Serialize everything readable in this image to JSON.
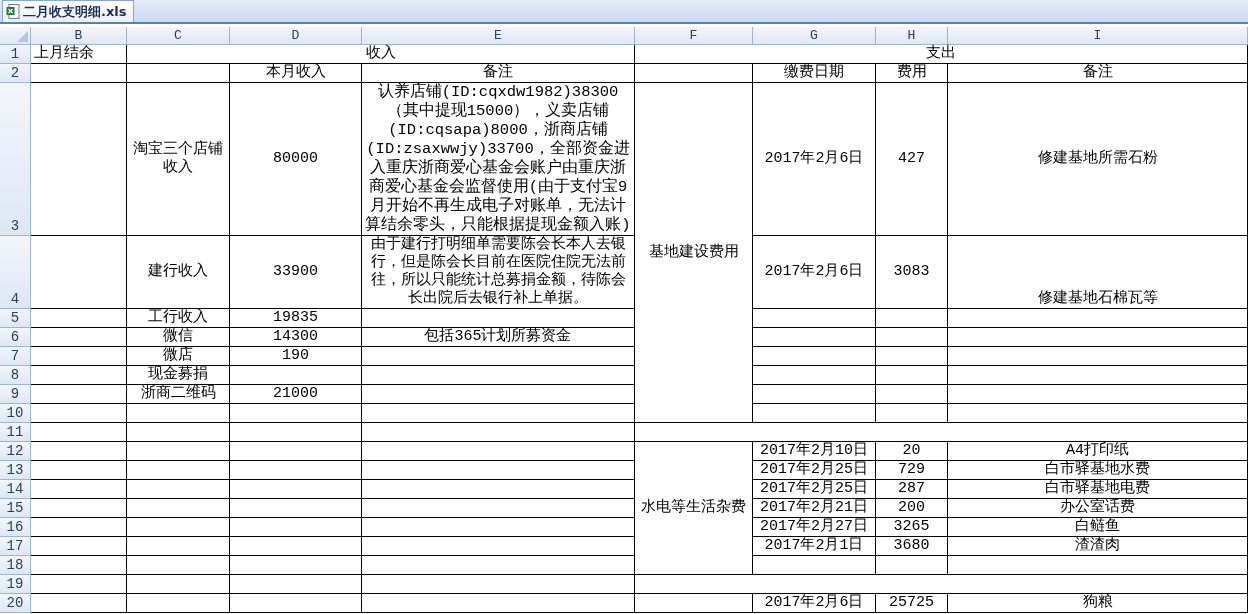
{
  "tab": {
    "title": "二月收支明细.xls",
    "selected": true
  },
  "column_headers": [
    "B",
    "C",
    "D",
    "E",
    "F",
    "G",
    "H",
    "I"
  ],
  "rows": [
    {
      "number": "1",
      "cells": [
        {
          "text": "上月结余"
        },
        {
          "text": "收入"
        },
        {
          "text": "支出"
        }
      ]
    },
    {
      "number": "2",
      "cells": [
        {
          "text": "本月收入"
        },
        {
          "text": "备注"
        },
        {
          "text": "缴费日期"
        },
        {
          "text": "费用"
        },
        {
          "text": "备注"
        }
      ]
    },
    {
      "number": "3",
      "cells": [
        {
          "text": "淘宝三个店铺收入"
        },
        {
          "text": "80000"
        },
        {
          "text": "认养店铺(ID:cqxdw1982)38300（其中提现15000），义卖店铺(ID:cqsapa)8000，浙商店铺(ID:zsaxwwjy)33700，全部资金进入重庆浙商爱心基金会账户由重庆浙商爱心基金会监督使用(由于支付宝9月开始不再生成电子对账单，无法计算结余零头，只能根据提现金额入账)"
        },
        {
          "text": "基地建设费用"
        },
        {
          "text": "2017年2月6日"
        },
        {
          "text": "427"
        },
        {
          "text": "修建基地所需石粉"
        }
      ]
    },
    {
      "number": "4",
      "cells": [
        {
          "text": "建行收入"
        },
        {
          "text": "33900"
        },
        {
          "text": "由于建行打明细单需要陈会长本人去银行，但是陈会长目前在医院住院无法前往，所以只能统计总募捐金额，待陈会长出院后去银行补上单据。"
        },
        {
          "text": "2017年2月6日"
        },
        {
          "text": "3083"
        },
        {
          "text": "修建基地石棉瓦等"
        }
      ]
    },
    {
      "number": "5",
      "cells": [
        {
          "text": "工行收入"
        },
        {
          "text": "19835"
        }
      ]
    },
    {
      "number": "6",
      "cells": [
        {
          "text": "微信"
        },
        {
          "text": "14300"
        },
        {
          "text": "包括365计划所募资金"
        }
      ]
    },
    {
      "number": "7",
      "cells": [
        {
          "text": "微店"
        },
        {
          "text": "190"
        }
      ]
    },
    {
      "number": "8",
      "cells": [
        {
          "text": "现金募捐"
        }
      ]
    },
    {
      "number": "9",
      "cells": [
        {
          "text": "浙商二维码"
        },
        {
          "text": "21000"
        }
      ]
    },
    {
      "number": "10",
      "cells": []
    },
    {
      "number": "11",
      "cells": []
    },
    {
      "number": "12",
      "cells": [
        {
          "text": "水电等生活杂费"
        },
        {
          "text": "2017年2月10日"
        },
        {
          "text": "20"
        },
        {
          "text": "A4打印纸"
        }
      ]
    },
    {
      "number": "13",
      "cells": [
        {
          "text": "2017年2月25日"
        },
        {
          "text": "729"
        },
        {
          "text": "白市驿基地水费"
        }
      ]
    },
    {
      "number": "14",
      "cells": [
        {
          "text": "2017年2月25日"
        },
        {
          "text": "287"
        },
        {
          "text": "白市驿基地电费"
        }
      ]
    },
    {
      "number": "15",
      "cells": [
        {
          "text": "2017年2月21日"
        },
        {
          "text": "200"
        },
        {
          "text": "办公室话费"
        }
      ]
    },
    {
      "number": "16",
      "cells": [
        {
          "text": "2017年2月27日"
        },
        {
          "text": "3265"
        },
        {
          "text": "白鲢鱼"
        }
      ]
    },
    {
      "number": "17",
      "cells": [
        {
          "text": "2017年2月1日"
        },
        {
          "text": "3680"
        },
        {
          "text": "渣渣肉"
        }
      ]
    },
    {
      "number": "18",
      "cells": []
    },
    {
      "number": "19",
      "cells": []
    },
    {
      "number": "20",
      "cells": [
        {
          "text": "2017年2月6日"
        },
        {
          "text": "25725"
        },
        {
          "text": "狗粮"
        }
      ]
    }
  ]
}
